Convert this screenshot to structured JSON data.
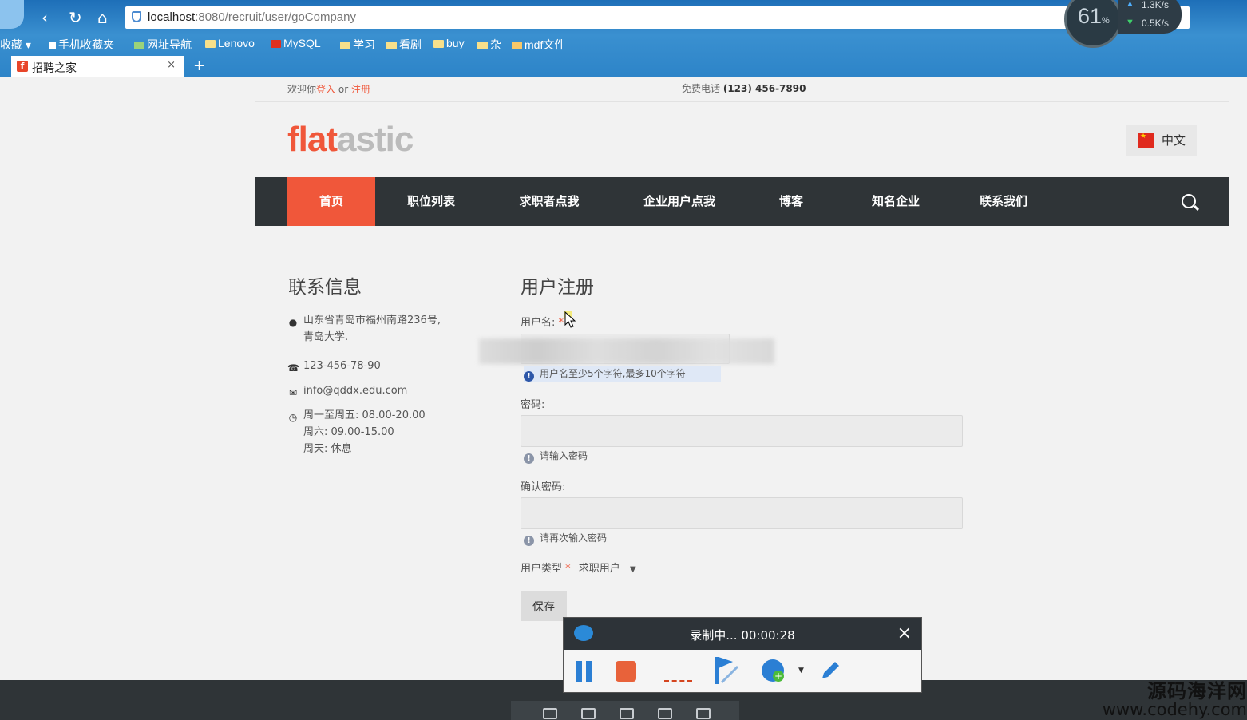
{
  "browser": {
    "url_host": "localhost",
    "url_rest": ":8080/recruit/user/goCompany",
    "bookmarks": [
      "收藏",
      "手机收藏夹",
      "网址导航",
      "Lenovo",
      "MySQL",
      "学习",
      "看剧",
      "buy",
      "杂",
      "mdf文件"
    ],
    "tab_title": "招聘之家",
    "tab_close": "×",
    "new_tab": "+",
    "net_percent": "61",
    "net_percent_unit": "%",
    "upload_speed": "1.3K/s",
    "download_speed": "0.5K/s"
  },
  "topbar": {
    "welcome_prefix": "欢迎你",
    "login_link": "登入",
    "or_text": " or ",
    "register_link": "注册",
    "phone_label": "免费电话 ",
    "phone_number": "(123) 456-7890"
  },
  "header": {
    "logo_part1": "flat",
    "logo_part2": "astic",
    "language": "中文"
  },
  "nav": {
    "items": [
      "首页",
      "职位列表",
      "求职者点我",
      "企业用户点我",
      "博客",
      "知名企业",
      "联系我们"
    ],
    "active_index": 0
  },
  "contact": {
    "title": "联系信息",
    "address_line1": "山东省青岛市福州南路236号,",
    "address_line2": "青岛大学.",
    "phone": "123-456-78-90",
    "email": "info@qddx.edu.com",
    "hours_line1": "周一至周五: 08.00-20.00",
    "hours_line2": "周六: 09.00-15.00",
    "hours_line3": "周天: 休息"
  },
  "register_form": {
    "title": "用户注册",
    "username_label": "用户名: ",
    "required_mark": "*",
    "username_hint": "用户名至少5个字符,最多10个字符",
    "password_label": "密码:",
    "password_hint": "请输入密码",
    "confirm_label": "确认密码:",
    "confirm_hint": "请再次输入密码",
    "usertype_label": "用户类型 ",
    "usertype_value": "求职用户",
    "save_button": "保存"
  },
  "recorder": {
    "status": "录制中... 00:00:28",
    "close": "×"
  },
  "watermark": {
    "line1": "源码海洋网",
    "line2": "www.codehy.com"
  },
  "colors": {
    "accent": "#f0573a",
    "nav_bg": "#2f3437",
    "page_bg": "#f2f2f2"
  }
}
